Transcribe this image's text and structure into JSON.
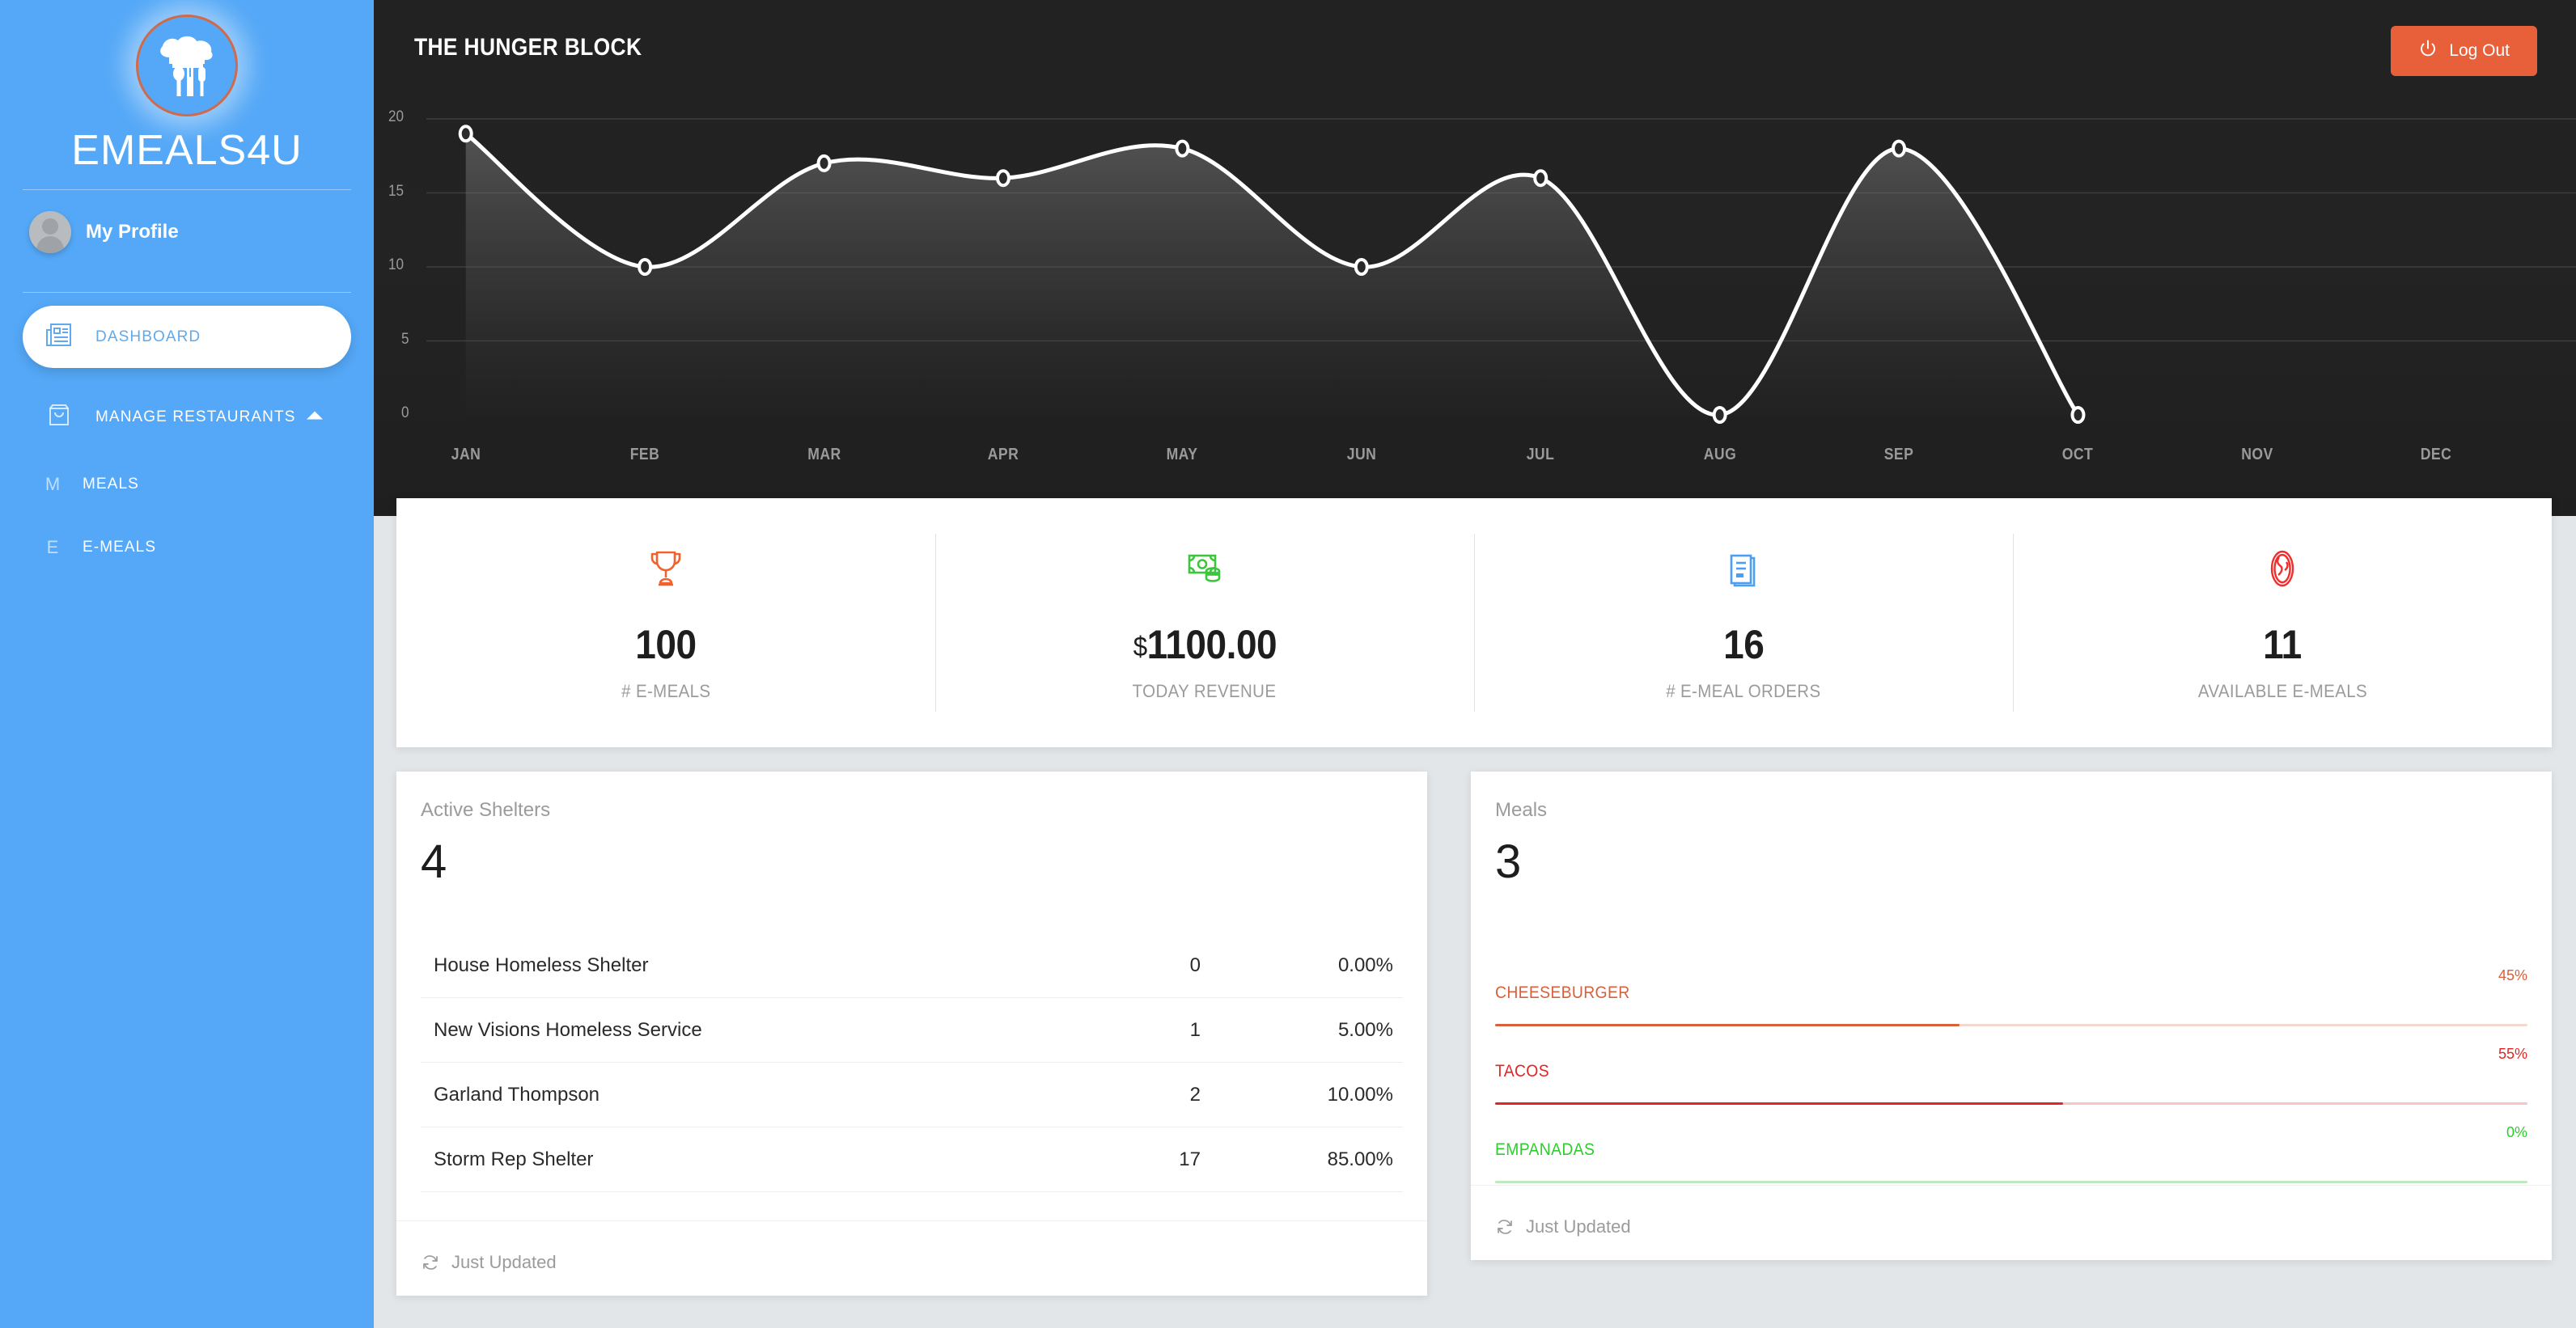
{
  "brand": {
    "name": "EMEALS4U",
    "logo_icon": "chef-hat-cutlery-icon"
  },
  "sidebar": {
    "profile": {
      "label": "My Profile",
      "avatar_icon": "user-avatar-icon"
    },
    "items": [
      {
        "id": "dashboard",
        "label": "DASHBOARD",
        "icon": "newspaper-icon",
        "active": true
      },
      {
        "id": "manage-restaurants",
        "label": "MANAGE RESTAURANTS",
        "icon": "shopping-bag-icon",
        "caret": "chevron-up-icon",
        "active": false
      },
      {
        "id": "meals",
        "label": "MEALS",
        "letter": "M",
        "active": false
      },
      {
        "id": "e-meals",
        "label": "E-MEALS",
        "letter": "E",
        "active": false
      }
    ]
  },
  "header": {
    "title": "THE HUNGER BLOCK",
    "logout_label": "Log Out",
    "logout_icon": "power-icon",
    "logout_color": "#e8603a"
  },
  "chart_data": {
    "type": "line",
    "title": "",
    "xlabel": "",
    "ylabel": "",
    "categories": [
      "JAN",
      "FEB",
      "MAR",
      "APR",
      "MAY",
      "JUN",
      "JUL",
      "AUG",
      "SEP",
      "OCT",
      "NOV",
      "DEC"
    ],
    "values": [
      19,
      10,
      17,
      16,
      18,
      10,
      16,
      0,
      18,
      0,
      null,
      null
    ],
    "ytick_labels": [
      "20",
      "15",
      "10",
      "5",
      "0"
    ],
    "yticks": [
      20,
      15,
      10,
      5,
      0
    ],
    "ylim": [
      0,
      20
    ],
    "grid": true,
    "legend": "none",
    "line_color": "#ffffff",
    "marker": "open-circle",
    "area_fill": "gradient-dark"
  },
  "stats": [
    {
      "icon": "trophy-icon",
      "icon_color": "#f2612c",
      "currency": "",
      "value": "100",
      "label": "# E-MEALS"
    },
    {
      "icon": "money-icon",
      "icon_color": "#3cc63c",
      "currency": "$",
      "value": "1100.00",
      "label": "TODAY REVENUE"
    },
    {
      "icon": "clipboard-list-icon",
      "icon_color": "#4a9ff5",
      "currency": "",
      "value": "16",
      "label": "# E-MEAL ORDERS"
    },
    {
      "icon": "steak-icon",
      "icon_color": "#f02e2e",
      "currency": "",
      "value": "11",
      "label": "AVAILABLE E-MEALS"
    }
  ],
  "shelters_panel": {
    "title": "Active Shelters",
    "count": "4",
    "footer_label": "Just Updated",
    "footer_icon": "refresh-icon",
    "rows": [
      {
        "name": "House Homeless Shelter",
        "count": "0",
        "percent": "0.00%"
      },
      {
        "name": "New Visions Homeless Service",
        "count": "1",
        "percent": "5.00%"
      },
      {
        "name": "Garland Thompson",
        "count": "2",
        "percent": "10.00%"
      },
      {
        "name": "Storm Rep Shelter",
        "count": "17",
        "percent": "85.00%"
      }
    ]
  },
  "meals_panel": {
    "title": "Meals",
    "count": "3",
    "footer_label": "Just Updated",
    "footer_icon": "refresh-icon",
    "items": [
      {
        "name": "CHEESEBURGER",
        "percent_label": "45%",
        "percent": 45,
        "color": "#d9603c",
        "track": "#f3d9cd"
      },
      {
        "name": "TACOS",
        "percent_label": "55%",
        "percent": 55,
        "color": "#e42525",
        "track": "#f6c5c5"
      },
      {
        "name": "EMPANADAS",
        "percent_label": "0%",
        "percent": 0,
        "color": "#2ecc2e",
        "track": "#bfe8bf"
      }
    ]
  }
}
